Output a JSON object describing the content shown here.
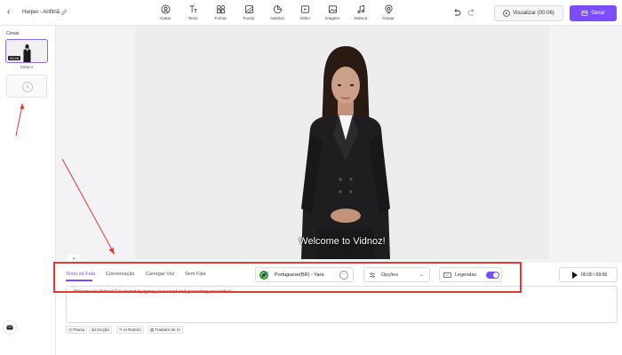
{
  "header": {
    "project_title": "Harper - Anfitriã",
    "tools": [
      {
        "label": "Avatar",
        "icon": "avatar-icon"
      },
      {
        "label": "Texto",
        "icon": "text-icon"
      },
      {
        "label": "Forma",
        "icon": "shape-icon"
      },
      {
        "label": "Fundo",
        "icon": "background-icon"
      },
      {
        "label": "Adesivo",
        "icon": "sticker-icon"
      },
      {
        "label": "Vídeo",
        "icon": "video-icon"
      },
      {
        "label": "Imagem",
        "icon": "image-icon"
      },
      {
        "label": "Música",
        "icon": "music-icon"
      },
      {
        "label": "Gravar",
        "icon": "record-icon"
      }
    ],
    "preview_label": "Visualizar (00:06)",
    "generate_label": "Gerar",
    "accent_color": "#7c4dff"
  },
  "scenes": {
    "title": "Cenas",
    "items": [
      {
        "label": "Cena 1",
        "duration": "00:06"
      }
    ]
  },
  "canvas": {
    "caption": "Welcome to Vidnoz!"
  },
  "script_panel": {
    "tabs": [
      "Texto de Fala",
      "Conversação",
      "Carregar Voz",
      "Sem Fala"
    ],
    "active_tab": "Texto de Fala",
    "voice": "Portuguese(BR) - Yara",
    "options_label": "Opções",
    "subtitles_label": "Legendas",
    "subtitles_on": true,
    "playback_time": "00:00 / 00:06",
    "script_text": "Welcome to Vidnoz! Get started by typing your script and generating your video!",
    "chips": [
      "Pausa",
      "Dicção",
      "IA Roteiro",
      "Tradutor de IA"
    ]
  },
  "annotation_color": "#e53935"
}
